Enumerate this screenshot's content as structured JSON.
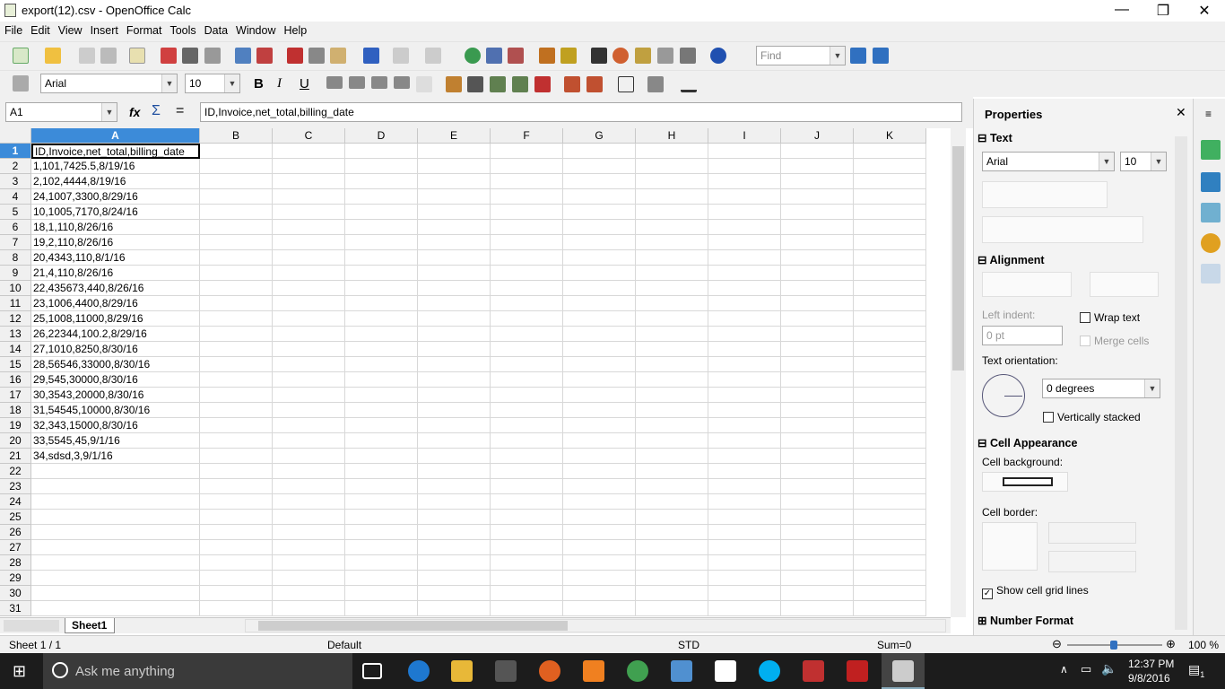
{
  "window": {
    "title": "export(12).csv - OpenOffice Calc",
    "minimize": "—",
    "restore": "❐",
    "close": "✕"
  },
  "menu": [
    "File",
    "Edit",
    "View",
    "Insert",
    "Format",
    "Tools",
    "Data",
    "Window",
    "Help"
  ],
  "toolbar": {
    "find_placeholder": "Find"
  },
  "format": {
    "font": "Arial",
    "size": "10",
    "bold": "B",
    "italic": "I",
    "underline": "U"
  },
  "formula_bar": {
    "name_box": "A1",
    "content": "ID,Invoice,net_total,billing_date"
  },
  "grid": {
    "columns": [
      "A",
      "B",
      "C",
      "D",
      "E",
      "F",
      "G",
      "H",
      "I",
      "J",
      "K"
    ],
    "rows": [
      "ID,Invoice,net_total,billing_date",
      "1,101,7425.5,8/19/16",
      "2,102,4444,8/19/16",
      "24,1007,3300,8/29/16",
      "10,1005,7170,8/24/16",
      "18,1,110,8/26/16",
      "19,2,110,8/26/16",
      "20,4343,110,8/1/16",
      "21,4,110,8/26/16",
      "22,435673,440,8/26/16",
      "23,1006,4400,8/29/16",
      "25,1008,11000,8/29/16",
      "26,22344,100.2,8/29/16",
      "27,1010,8250,8/30/16",
      "28,56546,33000,8/30/16",
      "29,545,30000,8/30/16",
      "30,3543,20000,8/30/16",
      "31,54545,10000,8/30/16",
      "32,343,15000,8/30/16",
      "33,5545,45,9/1/16",
      "34,sdsd,3,9/1/16",
      "",
      "",
      "",
      "",
      "",
      "",
      "",
      "",
      "",
      ""
    ],
    "selected_cell": "A1"
  },
  "sheet_tab": "Sheet1",
  "status": {
    "sheet": "Sheet 1 / 1",
    "style": "Default",
    "mode": "STD",
    "sum": "Sum=0",
    "zoom": "100 %",
    "zoom_level_percent": 100
  },
  "sidebar": {
    "title": "Properties",
    "text_section": "Text",
    "font": "Arial",
    "size": "10",
    "alignment_section": "Alignment",
    "left_indent_label": "Left indent:",
    "left_indent_value": "0 pt",
    "wrap_text": "Wrap text",
    "merge_cells": "Merge cells",
    "text_orientation": "Text orientation:",
    "orientation_value": "0 degrees",
    "vertically_stacked": "Vertically stacked",
    "cell_appearance_section": "Cell Appearance",
    "cell_background": "Cell background:",
    "cell_border": "Cell border:",
    "show_grid_lines": "Show cell grid lines",
    "number_format_section": "Number Format"
  },
  "taskbar": {
    "search": "Ask me anything",
    "time": "12:37 PM",
    "date": "9/8/2016",
    "notifications": "1"
  }
}
